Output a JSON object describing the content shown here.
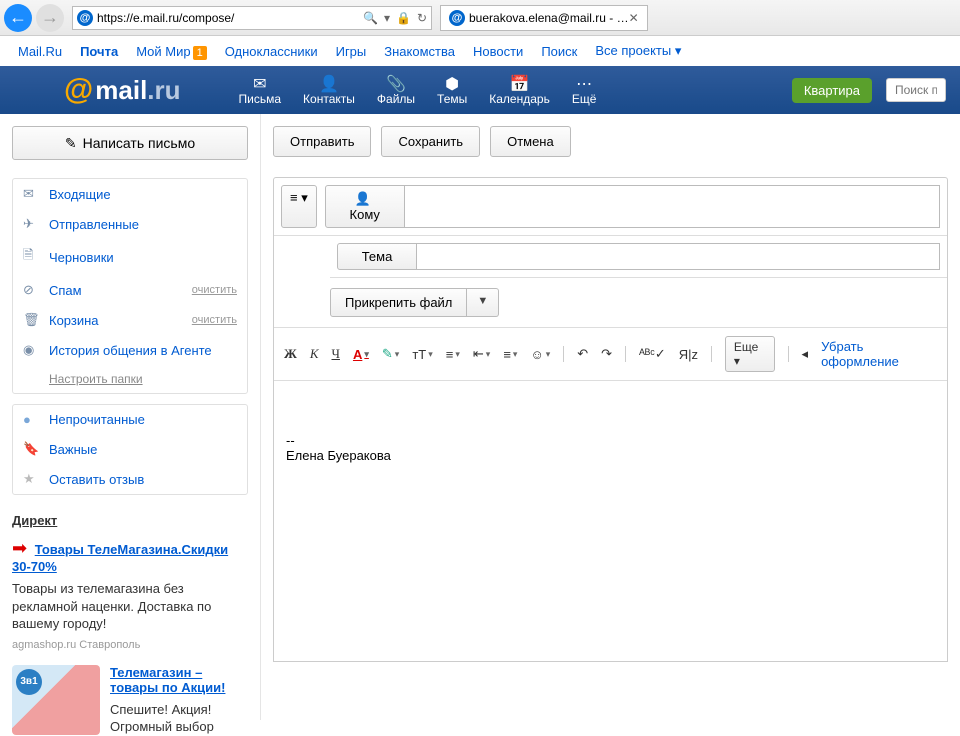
{
  "browser": {
    "url": "https://e.mail.ru/compose/",
    "tab_title": "buerakova.elena@mail.ru - …",
    "search_glyph": "🔍",
    "lock_glyph": "🔒",
    "refresh_glyph": "↻"
  },
  "topnav": {
    "items": [
      "Mail.Ru",
      "Почта",
      "Мой Мир",
      "Одноклассники",
      "Игры",
      "Знакомства",
      "Новости",
      "Поиск",
      "Все проекты"
    ],
    "badge": "1",
    "dropdown": "▾"
  },
  "header": {
    "logo_at": "@",
    "logo_main": "mail",
    "logo_ru": ".ru",
    "items": [
      {
        "icon": "✉",
        "label": "Письма"
      },
      {
        "icon": "👤",
        "label": "Контакты"
      },
      {
        "icon": "📎",
        "label": "Файлы"
      },
      {
        "icon": "⬢",
        "label": "Темы"
      },
      {
        "icon": "📅",
        "label": "Календарь"
      },
      {
        "icon": "⋯",
        "label": "Ещё"
      }
    ],
    "apartment": "Квартира",
    "search_placeholder": "Поиск п"
  },
  "sidebar": {
    "compose": "Написать письмо",
    "compose_icon": "✎",
    "folders": [
      {
        "icon": "✉",
        "label": "Входящие",
        "clear": ""
      },
      {
        "icon": "✈",
        "label": "Отправленные",
        "clear": ""
      },
      {
        "icon": "🗎",
        "label": "Черновики",
        "clear": ""
      },
      {
        "icon": "⊘",
        "label": "Спам",
        "clear": "очистить"
      },
      {
        "icon": "🗑",
        "label": "Корзина",
        "clear": "очистить"
      },
      {
        "icon": "◉",
        "label": "История общения в Агенте",
        "clear": ""
      }
    ],
    "configure": "Настроить папки",
    "filters": [
      {
        "icon": "●",
        "color": "#7aa7d8",
        "label": "Непрочитанные"
      },
      {
        "icon": "🔖",
        "color": "#c62828",
        "label": "Важные"
      },
      {
        "icon": "★",
        "color": "#bbb",
        "label": "Оставить отзыв"
      }
    ],
    "ad": {
      "header": "Директ",
      "arrow": "➡",
      "link1": "Товары ТелеМагазина.Скидки 30-70%",
      "text1": "Товары из телемагазина без рекламной наценки. Доставка по вашему городу!",
      "source1": "agmashop.ru Ставрополь",
      "badge2": "3в1",
      "link2": "Телемагазин – товары по Акции!",
      "text2": "Спешите! Акция! Огромный выбор"
    }
  },
  "compose": {
    "send": "Отправить",
    "save": "Сохранить",
    "cancel": "Отмена",
    "opts": "≡ ▾",
    "to_icon": "👤",
    "to_label": "Кому",
    "subject_label": "Тема",
    "attach": "Прикрепить файл",
    "attach_dd": "▼",
    "toolbar": {
      "bold": "Ж",
      "italic": "К",
      "under": "Ч",
      "color": "А",
      "bg": "✎",
      "size": "тТ",
      "align": "≡",
      "indent": "⇤",
      "list": "≡",
      "emoji": "☺",
      "undo": "↶",
      "redo": "↷",
      "spell": "ᴬᴮᶜ✓",
      "translit": "Я|z",
      "more": "Еще",
      "remove_fmt": "Убрать оформление",
      "dd": "▾",
      "collapse": "◂"
    },
    "signature_sep": "--",
    "signature_name": "Елена Буеракова"
  }
}
